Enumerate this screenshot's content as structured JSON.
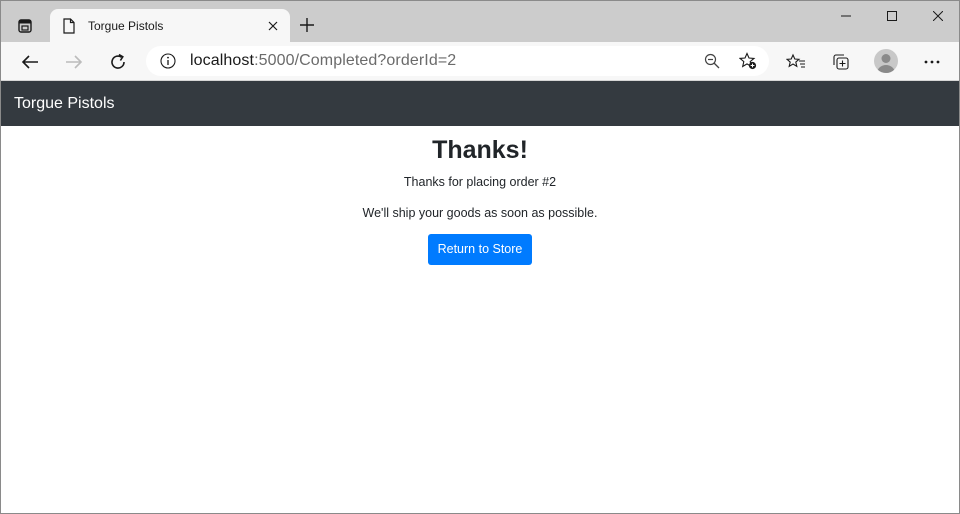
{
  "browser": {
    "tab_title": "Torgue Pistols",
    "url_host": "localhost",
    "url_rest": ":5000/Completed?orderId=2"
  },
  "icons": {
    "tab_actions": "tab-actions-icon",
    "page": "page-icon",
    "close_tab": "close-icon",
    "new_tab": "plus-icon",
    "minimize": "minimize-icon",
    "maximize": "maximize-icon",
    "close_window": "close-icon",
    "back": "back-arrow-icon",
    "forward": "forward-arrow-icon",
    "refresh": "refresh-icon",
    "site_info": "info-icon",
    "zoom": "zoom-out-icon",
    "favorite_add": "star-add-icon",
    "favorites": "favorites-icon",
    "collections": "collections-icon",
    "profile": "avatar",
    "more": "more-icon"
  },
  "site": {
    "brand": "Torgue Pistols"
  },
  "main": {
    "heading": "Thanks!",
    "order_message": "Thanks for placing order #2",
    "ship_message": "We'll ship your goods as soon as possible.",
    "return_button": "Return to Store"
  },
  "colors": {
    "navbar": "#343a40",
    "primary": "#007bff",
    "tabstrip": "#cccccc",
    "toolbar": "#f7f7f7"
  }
}
